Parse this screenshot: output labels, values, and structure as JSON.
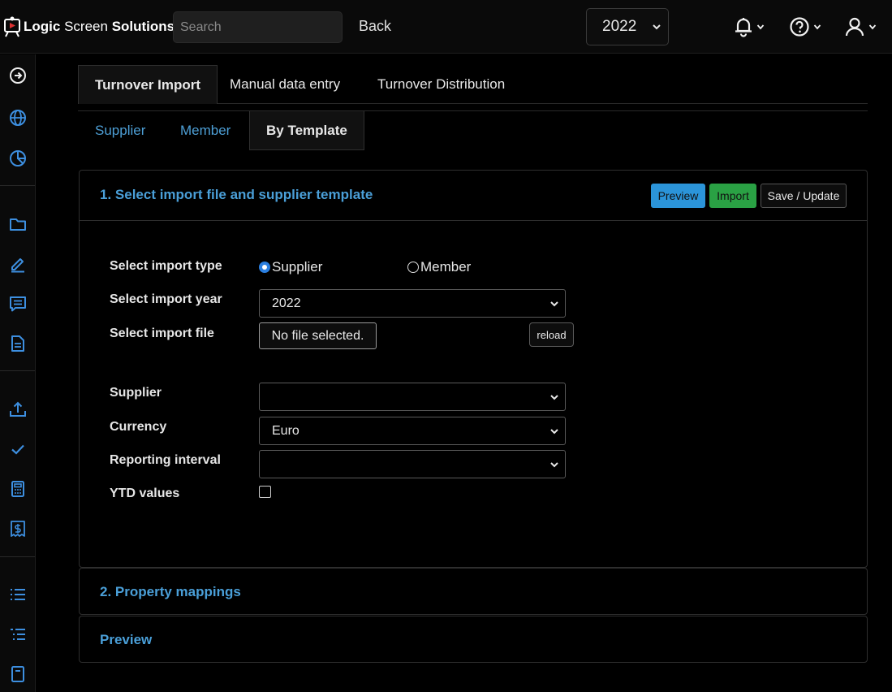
{
  "header": {
    "brand_first": "Logic",
    "brand_middle": "Screen",
    "brand_last": "Solutions",
    "search_placeholder": "Search",
    "back_label": "Back",
    "year": "2022"
  },
  "icons": {
    "header": [
      "bell-icon",
      "help-circle-icon",
      "user-icon"
    ],
    "sidebar": [
      "arrow-right-circle-icon",
      "globe-icon",
      "pie-chart-icon",
      "folder-icon",
      "pencil-icon",
      "message-list-icon",
      "document-icon",
      "upload-icon",
      "check-icon",
      "calculator-icon",
      "dollar-receipt-icon",
      "list-icon",
      "list-indent-icon",
      "bookmark-icon"
    ]
  },
  "tabs": {
    "main": [
      "Turnover Import",
      "Manual data entry",
      "Turnover Distribution"
    ],
    "sub": [
      "Supplier",
      "Member",
      "By Template"
    ]
  },
  "section1": {
    "title": "1. Select import file and supplier template",
    "preview_label": "Preview",
    "import_label": "Import",
    "save_label": "Save / Update",
    "import_type_label": "Select import type",
    "radio_supplier": "Supplier",
    "radio_member": "Member",
    "selected_type": "Supplier",
    "import_year_label": "Select import year",
    "import_year_value": "2022",
    "import_file_label": "Select import file",
    "file_button_text": "No file selected.",
    "reload_label": "reload",
    "supplier_label": "Supplier",
    "supplier_value": "",
    "currency_label": "Currency",
    "currency_value": "Euro",
    "interval_label": "Reporting interval",
    "interval_value": "",
    "ytd_label": "YTD values",
    "ytd_checked": false
  },
  "section2": {
    "title": "2. Property mappings"
  },
  "section3": {
    "title": "Preview"
  },
  "colors": {
    "accent_blue": "#4a9fd8",
    "preview_button": "#2b94d9",
    "import_button": "#2aa144",
    "background": "#000000"
  }
}
